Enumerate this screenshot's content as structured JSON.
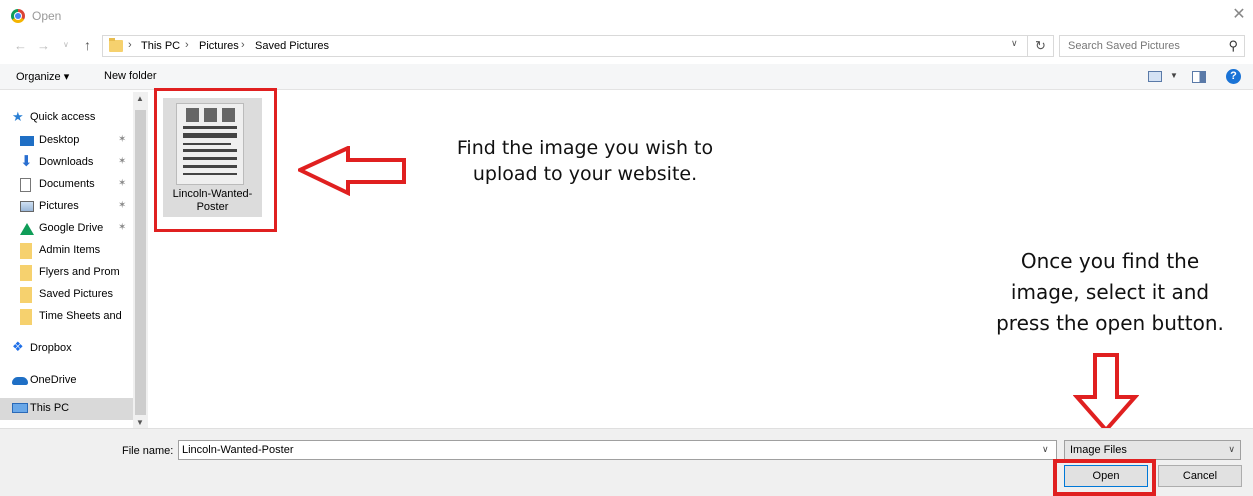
{
  "window": {
    "title": "Open",
    "close_glyph": "✕"
  },
  "nav": {
    "back": "←",
    "forward": "→",
    "recent": "∨",
    "up": "↑"
  },
  "breadcrumb": [
    "This PC",
    "Pictures",
    "Saved Pictures"
  ],
  "breadcrumb_sep": "›",
  "search": {
    "placeholder": "Search Saved Pictures"
  },
  "toolbar": {
    "organize": "Organize ▾",
    "new_folder": "New folder",
    "help": "?"
  },
  "sidebar": {
    "items": [
      {
        "label": "Quick access",
        "icon": "star-icon",
        "pinned": false
      },
      {
        "label": "Desktop",
        "icon": "desktop-icon",
        "pinned": true
      },
      {
        "label": "Downloads",
        "icon": "download-icon",
        "pinned": true
      },
      {
        "label": "Documents",
        "icon": "documents-icon",
        "pinned": true
      },
      {
        "label": "Pictures",
        "icon": "pictures-icon",
        "pinned": true
      },
      {
        "label": "Google Drive",
        "icon": "google-drive-icon",
        "pinned": true
      },
      {
        "label": "Admin Items",
        "icon": "folder-icon",
        "pinned": false
      },
      {
        "label": "Flyers and Prom",
        "icon": "folder-icon",
        "pinned": false
      },
      {
        "label": "Saved Pictures",
        "icon": "folder-icon",
        "pinned": false
      },
      {
        "label": "Time Sheets and",
        "icon": "folder-icon",
        "pinned": false
      },
      {
        "label": "Dropbox",
        "icon": "dropbox-icon",
        "pinned": false
      },
      {
        "label": "OneDrive",
        "icon": "onedrive-icon",
        "pinned": false
      },
      {
        "label": "This PC",
        "icon": "this-pc-icon",
        "pinned": false,
        "selected": true
      }
    ]
  },
  "file": {
    "name_line1": "Lincoln-Wanted-",
    "name_line2": "Poster"
  },
  "instructions": {
    "find_line1": "Find the image you wish to",
    "find_line2": "upload to your website.",
    "open_line1": "Once you find the",
    "open_line2": "image, select it and",
    "open_line3": "press the open button."
  },
  "bottom": {
    "filename_label": "File name:",
    "filename_value": "Lincoln-Wanted-Poster",
    "filetype": "Image Files",
    "open_label": "Open",
    "cancel_label": "Cancel"
  },
  "colors": {
    "annotation_red": "#e02020",
    "accent": "#0078d7"
  }
}
